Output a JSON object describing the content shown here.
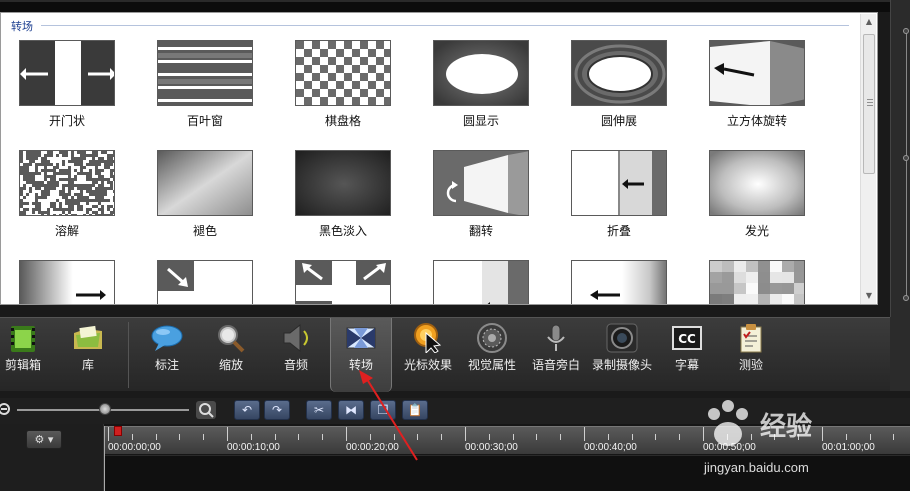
{
  "library": {
    "section_title": "转场",
    "tiles": [
      {
        "label": "开门状",
        "icon": "open-door-icon"
      },
      {
        "label": "百叶窗",
        "icon": "blinds-icon"
      },
      {
        "label": "棋盘格",
        "icon": "checkerboard-icon"
      },
      {
        "label": "圆显示",
        "icon": "circle-reveal-icon"
      },
      {
        "label": "圆伸展",
        "icon": "circle-stretch-icon"
      },
      {
        "label": "立方体旋转",
        "icon": "cube-rotate-icon"
      },
      {
        "label": "溶解",
        "icon": "dissolve-icon"
      },
      {
        "label": "褪色",
        "icon": "fade-icon"
      },
      {
        "label": "黑色淡入",
        "icon": "fade-through-black-icon"
      },
      {
        "label": "翻转",
        "icon": "flip-icon"
      },
      {
        "label": "折叠",
        "icon": "fold-icon"
      },
      {
        "label": "发光",
        "icon": "glow-icon"
      },
      {
        "label": "",
        "icon": "gradient-wipe-icon"
      },
      {
        "label": "",
        "icon": "inset-icon"
      },
      {
        "label": "",
        "icon": "mosaic-expand-icon"
      },
      {
        "label": "",
        "icon": "page-roll-icon"
      },
      {
        "label": "",
        "icon": "page-turn-icon"
      },
      {
        "label": "",
        "icon": "pixelate-icon"
      }
    ]
  },
  "toolbar": {
    "tools": [
      {
        "label": "剪辑箱",
        "icon": "film-clip-icon"
      },
      {
        "label": "库",
        "icon": "library-folder-icon"
      },
      {
        "label": "标注",
        "icon": "callout-bubble-icon"
      },
      {
        "label": "缩放",
        "icon": "magnifier-icon"
      },
      {
        "label": "音频",
        "icon": "speaker-icon"
      },
      {
        "label": "转场",
        "icon": "transition-icon"
      },
      {
        "label": "光标效果",
        "icon": "cursor-effect-icon"
      },
      {
        "label": "视觉属性",
        "icon": "visual-properties-icon"
      },
      {
        "label": "语音旁白",
        "icon": "microphone-icon"
      },
      {
        "label": "录制摄像头",
        "icon": "camera-icon"
      },
      {
        "label": "字幕",
        "icon": "captions-icon"
      },
      {
        "label": "测验",
        "icon": "quiz-icon"
      }
    ],
    "active": "转场"
  },
  "timeline": {
    "ruler": [
      "00:00:00;00",
      "00:00:10;00",
      "00:00:20;00",
      "00:00:30;00",
      "00:00:40;00",
      "00:00:50;00",
      "00:01:00;00"
    ],
    "playhead": "00:00:00;00"
  },
  "watermark": {
    "site": "经验",
    "url": "jingyan.baidu.com"
  },
  "colors": {
    "section_title": "#1d3f91",
    "annotation_arrow": "#e02020",
    "active_tool_bg": "#505050"
  }
}
